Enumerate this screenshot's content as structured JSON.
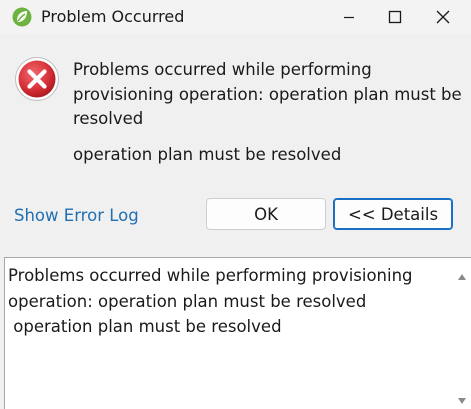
{
  "window": {
    "title": "Problem Occurred",
    "app_icon": "eclipse-spring-icon",
    "controls": [
      "minimize-icon",
      "maximize-icon",
      "close-icon"
    ]
  },
  "dialog": {
    "icon": "error-icon",
    "message": "Problems occurred while performing provisioning operation: operation plan must be resolved",
    "detail_summary": "operation plan must be resolved",
    "show_error_log_label": "Show Error Log",
    "ok_label": "OK",
    "details_label": "<< Details",
    "details_text": "Problems occurred while performing provisioning operation: operation plan must be resolved\n operation plan must be resolved"
  },
  "colors": {
    "background": "#f0f0f0",
    "link": "#1f6fb2",
    "error_red": "#d8333a",
    "focus_border": "#1a6fc4",
    "icon_green": "#6db33f"
  }
}
